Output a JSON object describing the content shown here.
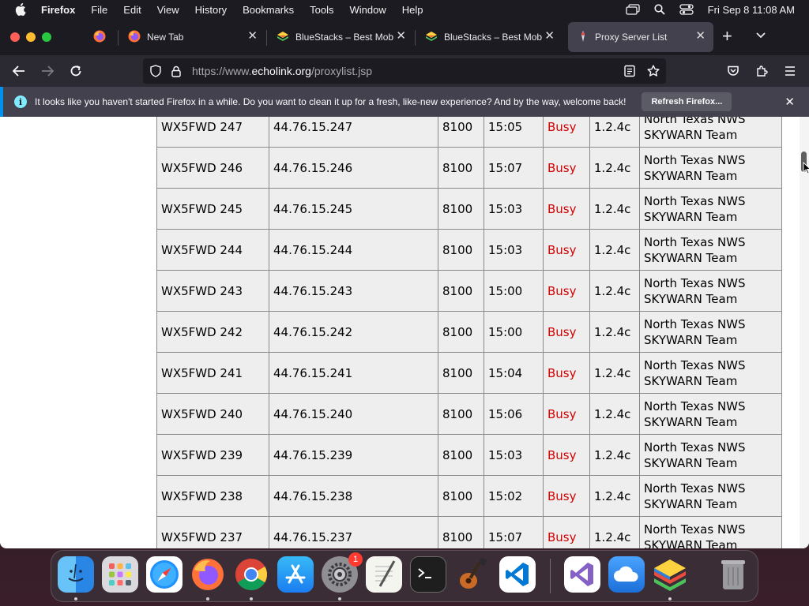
{
  "menubar": {
    "app_name": "Firefox",
    "items": [
      "File",
      "Edit",
      "View",
      "History",
      "Bookmarks",
      "Tools",
      "Window",
      "Help"
    ],
    "clock": "Fri Sep 8  11:08 AM"
  },
  "tabs": [
    {
      "title": "New Tab",
      "icon": "firefox-icon"
    },
    {
      "title": "BlueStacks – Best Mobile",
      "icon": "bluestacks-icon"
    },
    {
      "title": "BlueStacks – Best Mobile",
      "icon": "bluestacks-icon"
    },
    {
      "title": "Proxy Server List",
      "icon": "echolink-icon",
      "active": true
    }
  ],
  "url": {
    "prefix": "https://www.",
    "domain": "echolink.org",
    "path": "/proxylist.jsp"
  },
  "notification": {
    "message": "It looks like you haven't started Firefox in a while. Do you want to clean it up for a fresh, like-new experience? And by the way, welcome back!",
    "button": "Refresh Firefox..."
  },
  "proxy_table": {
    "rows": [
      {
        "callsign": "WX5FWD 247",
        "ip": "44.76.15.247",
        "port": "8100",
        "time": "15:05",
        "status": "Busy",
        "version": "1.2.4c",
        "owner": "North Texas NWS SKYWARN Team"
      },
      {
        "callsign": "WX5FWD 246",
        "ip": "44.76.15.246",
        "port": "8100",
        "time": "15:07",
        "status": "Busy",
        "version": "1.2.4c",
        "owner": "North Texas NWS SKYWARN Team"
      },
      {
        "callsign": "WX5FWD 245",
        "ip": "44.76.15.245",
        "port": "8100",
        "time": "15:03",
        "status": "Busy",
        "version": "1.2.4c",
        "owner": "North Texas NWS SKYWARN Team"
      },
      {
        "callsign": "WX5FWD 244",
        "ip": "44.76.15.244",
        "port": "8100",
        "time": "15:03",
        "status": "Busy",
        "version": "1.2.4c",
        "owner": "North Texas NWS SKYWARN Team"
      },
      {
        "callsign": "WX5FWD 243",
        "ip": "44.76.15.243",
        "port": "8100",
        "time": "15:00",
        "status": "Busy",
        "version": "1.2.4c",
        "owner": "North Texas NWS SKYWARN Team"
      },
      {
        "callsign": "WX5FWD 242",
        "ip": "44.76.15.242",
        "port": "8100",
        "time": "15:00",
        "status": "Busy",
        "version": "1.2.4c",
        "owner": "North Texas NWS SKYWARN Team"
      },
      {
        "callsign": "WX5FWD 241",
        "ip": "44.76.15.241",
        "port": "8100",
        "time": "15:04",
        "status": "Busy",
        "version": "1.2.4c",
        "owner": "North Texas NWS SKYWARN Team"
      },
      {
        "callsign": "WX5FWD 240",
        "ip": "44.76.15.240",
        "port": "8100",
        "time": "15:06",
        "status": "Busy",
        "version": "1.2.4c",
        "owner": "North Texas NWS SKYWARN Team"
      },
      {
        "callsign": "WX5FWD 239",
        "ip": "44.76.15.239",
        "port": "8100",
        "time": "15:03",
        "status": "Busy",
        "version": "1.2.4c",
        "owner": "North Texas NWS SKYWARN Team"
      },
      {
        "callsign": "WX5FWD 238",
        "ip": "44.76.15.238",
        "port": "8100",
        "time": "15:02",
        "status": "Busy",
        "version": "1.2.4c",
        "owner": "North Texas NWS SKYWARN Team"
      },
      {
        "callsign": "WX5FWD 237",
        "ip": "44.76.15.237",
        "port": "8100",
        "time": "15:07",
        "status": "Busy",
        "version": "1.2.4c",
        "owner": "North Texas NWS SKYWARN Team"
      }
    ],
    "status_color": "#d00000"
  },
  "dock": {
    "apps": [
      "finder-icon",
      "launchpad-icon",
      "safari-icon",
      "firefox-icon",
      "chrome-icon",
      "app-store-icon",
      "system-settings-icon",
      "textedit-icon",
      "terminal-icon",
      "garageband-icon",
      "vscode-icon",
      "visual-studio-icon",
      "icloud-icon",
      "bluestacks-icon",
      "trash-icon"
    ],
    "settings_badge": "1"
  }
}
